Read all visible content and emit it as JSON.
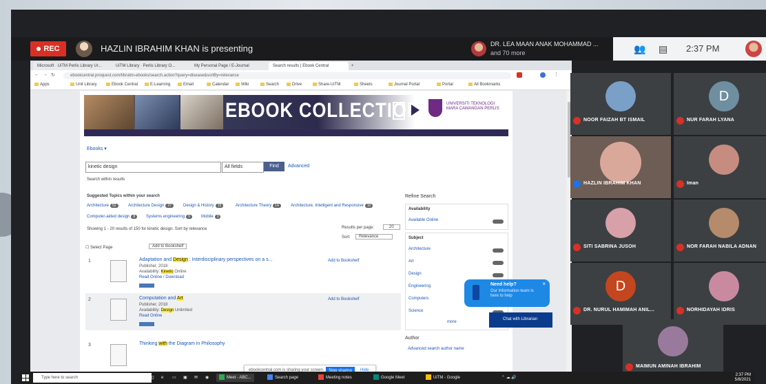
{
  "meet": {
    "rec_label": "REC",
    "presenter": "HAZLIN IBRAHIM KHAN is presenting",
    "pinned_name": "DR. LEA MAAN ANAK MOHAMMAD ...",
    "pinned_sub": "and 70 more",
    "time": "2:37 PM"
  },
  "browser": {
    "tabs": [
      "Microsoft · UiTM Perlis Library Ur...",
      "UiTM Library · Perlis Library O...",
      "My Personal Page / E-Journal",
      "Search results | Ebook Central",
      ""
    ],
    "url": "ebookcentral.proquest.com/lib/uitm-ebooks/search.action?query=disease&sortBy=relevance",
    "bookmarks": [
      "Apps",
      "Unit Library",
      "Ebook Central",
      "E-Learning",
      "Email",
      "Calendar",
      "Wiki",
      "Search",
      "Drive",
      "Share-UiTM",
      "Sheets",
      "Journal Portal",
      "Portal",
      "All Bookmarks"
    ]
  },
  "page": {
    "banner_title": "EBOOK COLLECTION",
    "banner_uni": "UNIVERSITI TEKNOLOGI MARA CAWANGAN PERLIS",
    "breadcrumb": "Ebooks ▾",
    "search_value": "kinetic design",
    "search_scope": "All fields",
    "search_button": "Find",
    "advanced": "Advanced",
    "search_tips": "Search within results",
    "suggested_label": "Suggested Topics within your search",
    "topics": [
      {
        "label": "Architecture",
        "count": "52"
      },
      {
        "label": "Architecture Design",
        "count": "27"
      },
      {
        "label": "Design & History",
        "count": "15"
      },
      {
        "label": "Architecture Theory",
        "count": "14"
      },
      {
        "label": "Architecture, Intelligent and Responsive",
        "count": "10"
      },
      {
        "label": "Computer-aided design",
        "count": "8"
      },
      {
        "label": "Systems engineering",
        "count": "9"
      },
      {
        "label": "Mobile",
        "count": "3"
      }
    ],
    "results_info": "Showing 1 - 20 results of 150 for kinetic design. Sort by relevance",
    "results_per_page_label": "Results per page:",
    "results_per_page": "20",
    "sort_label": "Sort:",
    "sort_value": "Relevance",
    "select_label": "Select Page",
    "add_shelf": "Add to Bookshelf",
    "results": [
      {
        "num": "1",
        "title_pre": "Adaptation and ",
        "title_hl": "Design",
        "title_post": " : Interdisciplinary perspectives on a s...",
        "meta1": "Publisher, 2018",
        "meta2_pre": "Availability: ",
        "meta2_hl": "Kinetic",
        "meta2_post": " Online",
        "meta3": "Read Online / Download",
        "save": "Add to Bookshelf"
      },
      {
        "num": "2",
        "title_pre": "Computation and ",
        "title_hl": "Art",
        "title_post": "",
        "meta1": "Publisher, 2018",
        "meta2_pre": "Availability: ",
        "meta2_hl": "Design",
        "meta2_post": " Unlimited",
        "meta3": "Read Online",
        "save": "Add to Bookshelf"
      },
      {
        "num": "3",
        "title_pre": "Thinking ",
        "title_hl": "with",
        "title_post": " the Diagram in Philosophy",
        "meta1": "",
        "meta2_pre": "",
        "meta2_hl": "",
        "meta2_post": "",
        "meta3": "",
        "save": ""
      }
    ],
    "facets": {
      "refine_label": "Refine Search",
      "availability": "Availability",
      "available_online": "Available Online",
      "subject": "Subject",
      "subjects": [
        "Architecture",
        "Art",
        "Design",
        "Engineering",
        "Computers",
        "Science"
      ],
      "more": "more",
      "author": "Author",
      "author_item": "Advanced search author name"
    },
    "toast_text": "ebookcentral.com is sharing your screen.",
    "toast_stop": "Stop sharing",
    "toast_hide": "Hide",
    "help_title": "Need help?",
    "help_text": "Our Information team is here to help",
    "help_close": "×",
    "chat_label": "Chat with Librarian"
  },
  "participants": [
    {
      "name": "NOOR FAIZAH BT ISMAIL",
      "letter": "",
      "color": "#7aa0c8"
    },
    {
      "name": "NUR FARAH LYANA",
      "letter": "D",
      "color": "#6f8fa0"
    },
    {
      "name": "HAZLIN IBRAHIM KHAN",
      "letter": "",
      "color": "#8a6b5a"
    },
    {
      "name": "Iman",
      "letter": "",
      "color": "#c78c80"
    },
    {
      "name": "SITI SABRINA JUSOH",
      "letter": "",
      "color": "#d8a0a8"
    },
    {
      "name": "NOR FARAH NABILA ADNAN",
      "letter": "",
      "color": "#b58b6b"
    },
    {
      "name": "DR. NURUL HAMIMAH ANIL...",
      "letter": "D",
      "color": "#c4461f"
    },
    {
      "name": "NORHIDAYAH IDRIS",
      "letter": "",
      "color": "#c98aa0"
    },
    {
      "name": "MAIMUN AMINAH IBRAHIM",
      "letter": "",
      "color": "#9a7a9c"
    }
  ],
  "taskbar": {
    "search_placeholder": "Type here to search",
    "items": [
      "Meet - ABC...",
      "Search page",
      "Meeting notes",
      "Google Meet",
      "UiTM - Google"
    ],
    "time": "2:37 PM",
    "date": "5/8/2021"
  }
}
